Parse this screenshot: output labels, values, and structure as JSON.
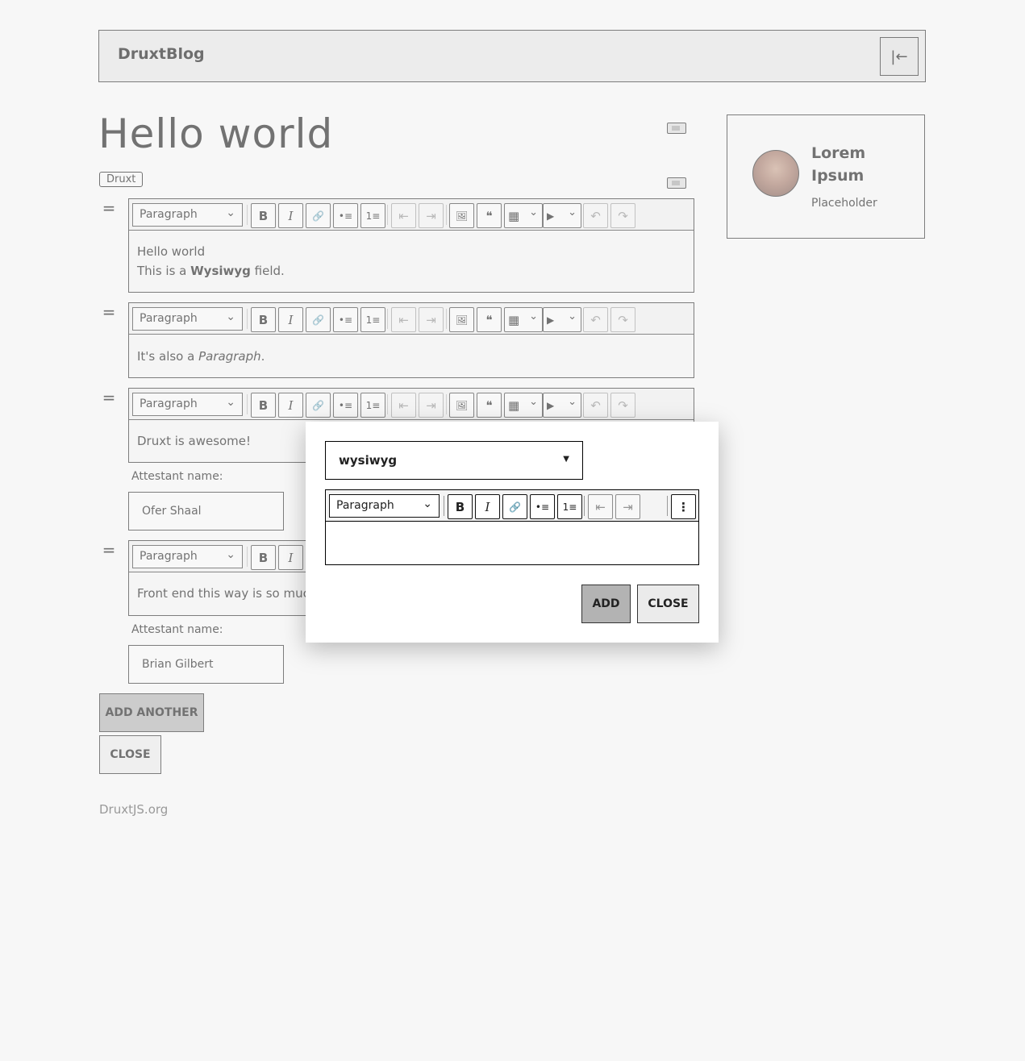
{
  "header": {
    "brand": "DruxtBlog",
    "collapse_icon": "|←"
  },
  "article": {
    "title": "Hello world",
    "tag": "Druxt"
  },
  "toolbar": {
    "format": "Paragraph",
    "bold": "B",
    "italic": "I",
    "link": "🔗",
    "bulleted": "•≡",
    "numbered": "1≡",
    "outdent": "⇤",
    "indent": "⇥",
    "image": "🖼",
    "quote": "❝",
    "table": "▦",
    "media": "▶",
    "undo": "↶",
    "redo": "↷",
    "more": "⋮"
  },
  "paragraphs": [
    {
      "line1": "Hello world",
      "line2_prefix": "This is a ",
      "line2_bold": "Wysiwyg",
      "line2_suffix": " field."
    },
    {
      "prefix": "It's also a ",
      "italic": "Paragraph",
      "suffix": "."
    },
    {
      "text": "Druxt is awesome!",
      "attestant_label": "Attestant name:",
      "attestant_value": "Ofer Shaal"
    },
    {
      "text": "Front end this way is so muc",
      "attestant_label": "Attestant name:",
      "attestant_value": "Brian Gilbert"
    }
  ],
  "actions": {
    "add_another": "ADD ANOTHER",
    "close": "CLOSE"
  },
  "author": {
    "name_line1": "Lorem",
    "name_line2": "Ipsum",
    "role": "Placeholder"
  },
  "footer": {
    "link": "DruxtJS.org"
  },
  "modal": {
    "type_value": "wysiwyg",
    "add": "ADD",
    "close": "CLOSE"
  }
}
